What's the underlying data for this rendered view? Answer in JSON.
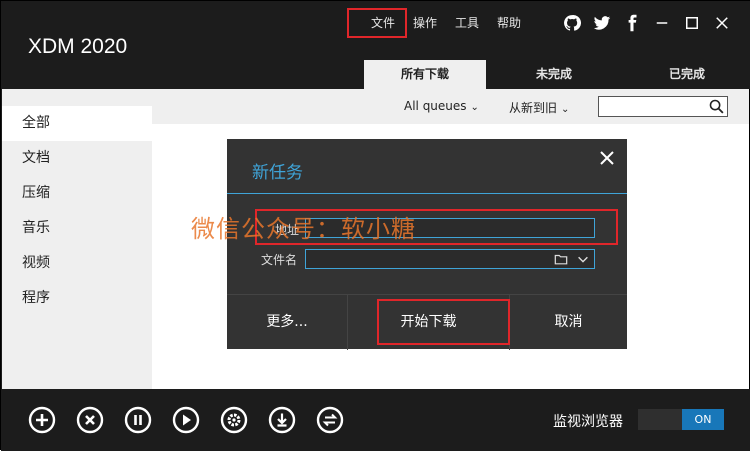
{
  "app": {
    "title": "XDM 2020"
  },
  "menu": [
    "文件",
    "操作",
    "工具",
    "帮助"
  ],
  "tabs": [
    "所有下载",
    "未完成",
    "已完成"
  ],
  "sidebar": {
    "items": [
      "全部",
      "文档",
      "压缩",
      "音乐",
      "视频",
      "程序"
    ]
  },
  "filters": {
    "queues": "All queues",
    "sort": "从新到旧",
    "search_placeholder": ""
  },
  "dialog": {
    "title": "新任务",
    "url_label": "地址",
    "filename_label": "文件名",
    "buttons": {
      "more": "更多...",
      "start": "开始下载",
      "cancel": "取消"
    }
  },
  "watermark": "微信公众号：软小糖",
  "bottom": {
    "monitor_label": "监视浏览器",
    "toggle_state": "ON"
  },
  "colors": {
    "accent": "#3fa4d8",
    "toggle_on": "#1877b9",
    "highlight": "#e0262a"
  }
}
